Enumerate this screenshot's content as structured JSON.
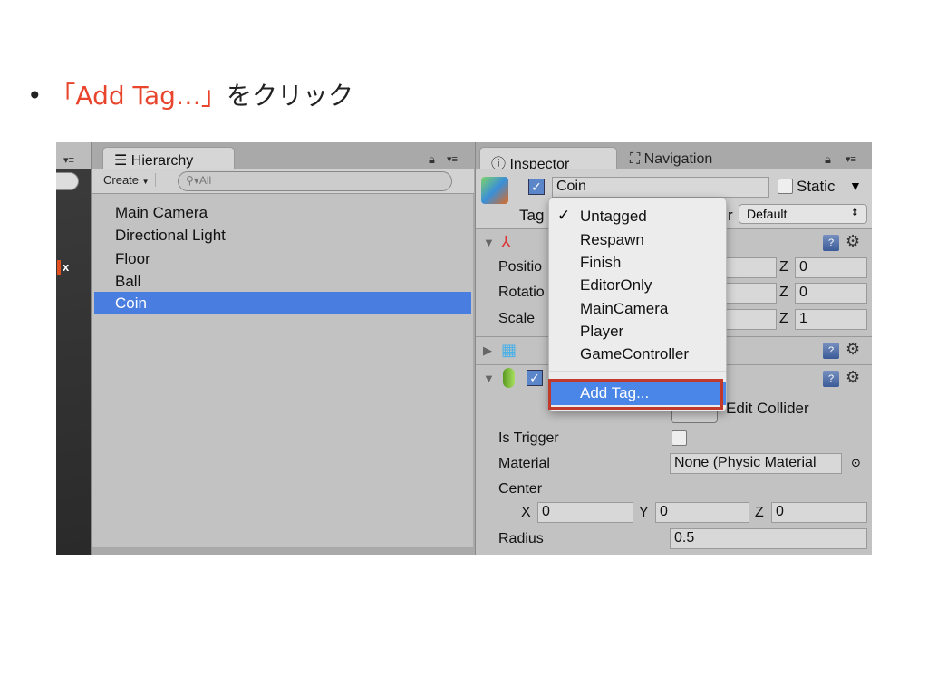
{
  "instruction": {
    "bullet": "•",
    "highlight": "「Add Tag…」",
    "rest": "をクリック"
  },
  "hierarchy": {
    "tab_label": "Hierarchy",
    "create_label": "Create",
    "search_placeholder": "All",
    "items": [
      "Main Camera",
      "Directional Light",
      "Floor",
      "Ball",
      "Coin"
    ],
    "selected": "Coin"
  },
  "scene": {
    "axis_label": "x"
  },
  "inspector": {
    "tab_label": "Inspector",
    "nav_tab_label": "Navigation",
    "object_name": "Coin",
    "active": true,
    "static_label": "Static",
    "static_checked": false,
    "tag_label": "Tag",
    "layer_label_fragment": "r",
    "layer_value": "Default",
    "transform": {
      "position_label": "Positio",
      "rotation_label": "Rotatio",
      "scale_label": "Scale",
      "z_label": "Z",
      "position_z": "0",
      "rotation_z": "0",
      "scale_z": "1"
    },
    "collider": {
      "edit_collider_label": "Edit Collider",
      "is_trigger_label": "Is Trigger",
      "is_trigger": false,
      "material_label": "Material",
      "material_value": "None (Physic Material",
      "center_label": "Center",
      "x_label": "X",
      "x": "0",
      "y_label": "Y",
      "y": "0",
      "z_label": "Z",
      "z": "0",
      "radius_label": "Radius",
      "radius": "0.5"
    }
  },
  "tag_menu": {
    "items": [
      "Untagged",
      "Respawn",
      "Finish",
      "EditorOnly",
      "MainCamera",
      "Player",
      "GameController"
    ],
    "checked": "Untagged",
    "add_tag": "Add Tag...",
    "highlight_color": "#4a86e8",
    "callout_color": "#c0392b"
  }
}
